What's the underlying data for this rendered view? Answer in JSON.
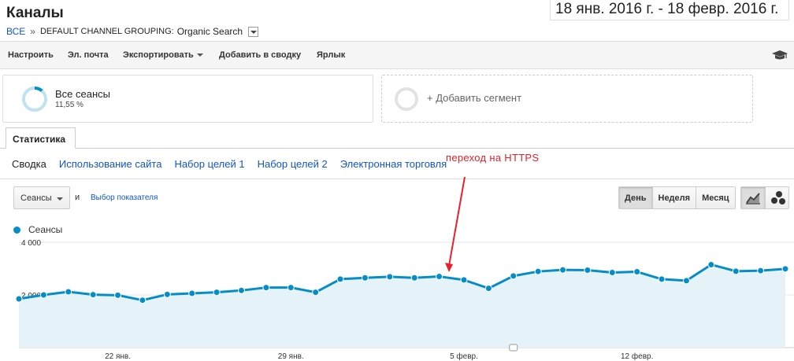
{
  "header": {
    "title": "Каналы",
    "date_range": "18 янв. 2016 г. - 18 февр. 2016 г."
  },
  "breadcrumb": {
    "root": "ВСЕ",
    "separator": "»",
    "dimension_label": "DEFAULT CHANNEL GROUPING:",
    "dimension_value": "Organic Search"
  },
  "toolbar": {
    "customize": "Настроить",
    "email": "Эл. почта",
    "export": "Экспортировать",
    "add_to_dashboard": "Добавить в сводку",
    "shortcut": "Ярлык",
    "academy_icon": "graduation-cap-icon"
  },
  "segments": {
    "active_name": "Все сеансы",
    "active_percent": "11,55 %",
    "add_label": "+ Добавить сегмент"
  },
  "tabs": {
    "main": "Статистика",
    "sub": [
      "Сводка",
      "Использование сайта",
      "Набор целей 1",
      "Набор целей 2",
      "Электронная торговля"
    ]
  },
  "annotation": "переход на HTTPS",
  "chart_controls": {
    "metric": "Сеансы",
    "and": "и",
    "choose_metric": "Выбор показателя",
    "periods": [
      "День",
      "Неделя",
      "Месяц"
    ],
    "active_period": "День",
    "chart_type_icons": [
      "line-chart-icon",
      "motion-chart-icon"
    ]
  },
  "colors": {
    "series": "#058dc7",
    "fill": "#e5f3f9",
    "annotation": "#e8202a",
    "link": "#1155cc"
  },
  "chart_data": {
    "type": "area",
    "series": [
      {
        "name": "Сеансы",
        "values": [
          1850,
          2000,
          2120,
          2010,
          1990,
          1800,
          2020,
          2060,
          2100,
          2170,
          2280,
          2280,
          2100,
          2600,
          2650,
          2690,
          2650,
          2700,
          2570,
          2250,
          2720,
          2890,
          2950,
          2940,
          2850,
          2880,
          2600,
          2540,
          3150,
          2900,
          2920,
          2990
        ]
      }
    ],
    "x": [
      "18 янв.",
      "19 янв.",
      "20 янв.",
      "21 янв.",
      "22 янв.",
      "23 янв.",
      "24 янв.",
      "25 янв.",
      "26 янв.",
      "27 янв.",
      "28 янв.",
      "29 янв.",
      "30 янв.",
      "31 янв.",
      "1 февр.",
      "2 февр.",
      "3 февр.",
      "4 февр.",
      "5 февр.",
      "6 февр.",
      "7 февр.",
      "8 февр.",
      "9 февр.",
      "10 февр.",
      "11 февр.",
      "12 февр.",
      "13 февр.",
      "14 февр.",
      "15 февр.",
      "16 февр.",
      "17 февр.",
      "18 февр."
    ],
    "x_tick_labels": [
      "22 янв.",
      "29 янв.",
      "5 февр.",
      "12 февр."
    ],
    "y_tick_labels": [
      "4 000",
      "2 000"
    ],
    "ylim": [
      0,
      4000
    ],
    "grid": true
  }
}
